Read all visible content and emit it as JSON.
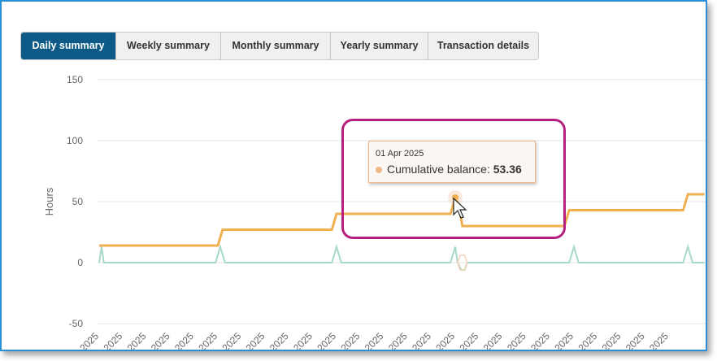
{
  "tabs": [
    {
      "label": "Daily summary",
      "active": true
    },
    {
      "label": "Weekly summary",
      "active": false
    },
    {
      "label": "Monthly summary",
      "active": false
    },
    {
      "label": "Yearly summary",
      "active": false
    },
    {
      "label": "Transaction details",
      "active": false
    }
  ],
  "tooltip": {
    "date": "01 Apr 2025",
    "label": "Cumulative balance:",
    "value": "53.36"
  },
  "colors": {
    "balance": "#f0b050",
    "daily": "#a8d8cc",
    "highlight": "#b51f7d",
    "active_tab": "#0e5a87"
  },
  "cursor": "mouse-pointer-icon",
  "chart_data": {
    "type": "line",
    "ylabel": "Hours",
    "ylim": [
      -50,
      150
    ],
    "yticks": [
      150,
      100,
      50,
      0,
      -50
    ],
    "grid": true,
    "xtick_label": "2025",
    "xtick_count": 25,
    "series": [
      {
        "values_x": [
          0,
          10,
          10.4,
          19.6,
          20,
          29.6,
          30,
          30.3,
          30.6,
          39.2,
          39.6,
          49.2,
          49.6,
          51
        ],
        "values_y": [
          14,
          14,
          27,
          27,
          40,
          40,
          53.36,
          47,
          30,
          30,
          43,
          43,
          56,
          56
        ]
      },
      {
        "values_x": [
          0,
          0.2,
          0.4,
          9.8,
          10.2,
          10.6,
          19.6,
          20,
          20.4,
          29.6,
          30,
          30.2,
          30.5,
          30.8,
          31,
          39.6,
          40,
          40.4,
          49.2,
          49.6,
          50,
          51
        ],
        "values_y": [
          0,
          13,
          0,
          0,
          13,
          0,
          0,
          13,
          0,
          0,
          13,
          0,
          -6,
          -6,
          0,
          0,
          13,
          0,
          0,
          13,
          0,
          0
        ]
      }
    ]
  }
}
